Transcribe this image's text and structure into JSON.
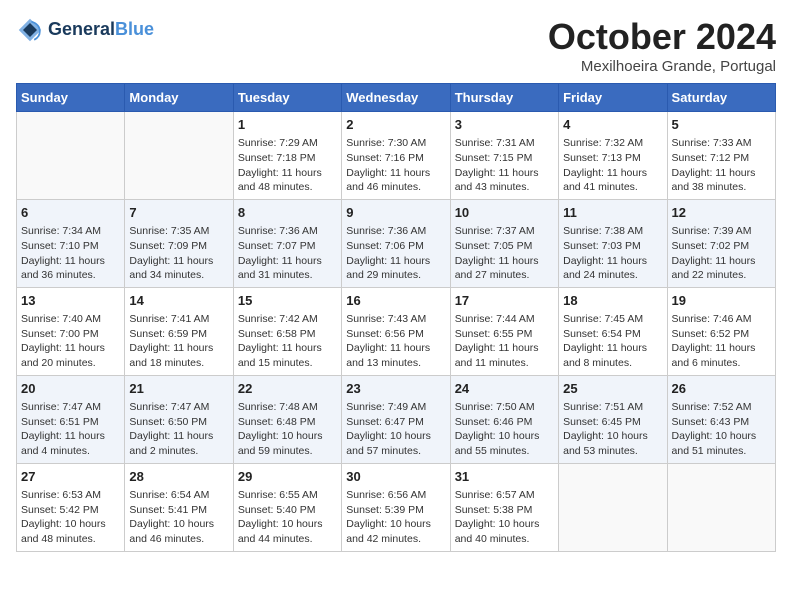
{
  "header": {
    "logo_line1": "General",
    "logo_line2": "Blue",
    "month": "October 2024",
    "location": "Mexilhoeira Grande, Portugal"
  },
  "days_of_week": [
    "Sunday",
    "Monday",
    "Tuesday",
    "Wednesday",
    "Thursday",
    "Friday",
    "Saturday"
  ],
  "weeks": [
    [
      {
        "day": "",
        "content": ""
      },
      {
        "day": "",
        "content": ""
      },
      {
        "day": "1",
        "content": "Sunrise: 7:29 AM\nSunset: 7:18 PM\nDaylight: 11 hours and 48 minutes."
      },
      {
        "day": "2",
        "content": "Sunrise: 7:30 AM\nSunset: 7:16 PM\nDaylight: 11 hours and 46 minutes."
      },
      {
        "day": "3",
        "content": "Sunrise: 7:31 AM\nSunset: 7:15 PM\nDaylight: 11 hours and 43 minutes."
      },
      {
        "day": "4",
        "content": "Sunrise: 7:32 AM\nSunset: 7:13 PM\nDaylight: 11 hours and 41 minutes."
      },
      {
        "day": "5",
        "content": "Sunrise: 7:33 AM\nSunset: 7:12 PM\nDaylight: 11 hours and 38 minutes."
      }
    ],
    [
      {
        "day": "6",
        "content": "Sunrise: 7:34 AM\nSunset: 7:10 PM\nDaylight: 11 hours and 36 minutes."
      },
      {
        "day": "7",
        "content": "Sunrise: 7:35 AM\nSunset: 7:09 PM\nDaylight: 11 hours and 34 minutes."
      },
      {
        "day": "8",
        "content": "Sunrise: 7:36 AM\nSunset: 7:07 PM\nDaylight: 11 hours and 31 minutes."
      },
      {
        "day": "9",
        "content": "Sunrise: 7:36 AM\nSunset: 7:06 PM\nDaylight: 11 hours and 29 minutes."
      },
      {
        "day": "10",
        "content": "Sunrise: 7:37 AM\nSunset: 7:05 PM\nDaylight: 11 hours and 27 minutes."
      },
      {
        "day": "11",
        "content": "Sunrise: 7:38 AM\nSunset: 7:03 PM\nDaylight: 11 hours and 24 minutes."
      },
      {
        "day": "12",
        "content": "Sunrise: 7:39 AM\nSunset: 7:02 PM\nDaylight: 11 hours and 22 minutes."
      }
    ],
    [
      {
        "day": "13",
        "content": "Sunrise: 7:40 AM\nSunset: 7:00 PM\nDaylight: 11 hours and 20 minutes."
      },
      {
        "day": "14",
        "content": "Sunrise: 7:41 AM\nSunset: 6:59 PM\nDaylight: 11 hours and 18 minutes."
      },
      {
        "day": "15",
        "content": "Sunrise: 7:42 AM\nSunset: 6:58 PM\nDaylight: 11 hours and 15 minutes."
      },
      {
        "day": "16",
        "content": "Sunrise: 7:43 AM\nSunset: 6:56 PM\nDaylight: 11 hours and 13 minutes."
      },
      {
        "day": "17",
        "content": "Sunrise: 7:44 AM\nSunset: 6:55 PM\nDaylight: 11 hours and 11 minutes."
      },
      {
        "day": "18",
        "content": "Sunrise: 7:45 AM\nSunset: 6:54 PM\nDaylight: 11 hours and 8 minutes."
      },
      {
        "day": "19",
        "content": "Sunrise: 7:46 AM\nSunset: 6:52 PM\nDaylight: 11 hours and 6 minutes."
      }
    ],
    [
      {
        "day": "20",
        "content": "Sunrise: 7:47 AM\nSunset: 6:51 PM\nDaylight: 11 hours and 4 minutes."
      },
      {
        "day": "21",
        "content": "Sunrise: 7:47 AM\nSunset: 6:50 PM\nDaylight: 11 hours and 2 minutes."
      },
      {
        "day": "22",
        "content": "Sunrise: 7:48 AM\nSunset: 6:48 PM\nDaylight: 10 hours and 59 minutes."
      },
      {
        "day": "23",
        "content": "Sunrise: 7:49 AM\nSunset: 6:47 PM\nDaylight: 10 hours and 57 minutes."
      },
      {
        "day": "24",
        "content": "Sunrise: 7:50 AM\nSunset: 6:46 PM\nDaylight: 10 hours and 55 minutes."
      },
      {
        "day": "25",
        "content": "Sunrise: 7:51 AM\nSunset: 6:45 PM\nDaylight: 10 hours and 53 minutes."
      },
      {
        "day": "26",
        "content": "Sunrise: 7:52 AM\nSunset: 6:43 PM\nDaylight: 10 hours and 51 minutes."
      }
    ],
    [
      {
        "day": "27",
        "content": "Sunrise: 6:53 AM\nSunset: 5:42 PM\nDaylight: 10 hours and 48 minutes."
      },
      {
        "day": "28",
        "content": "Sunrise: 6:54 AM\nSunset: 5:41 PM\nDaylight: 10 hours and 46 minutes."
      },
      {
        "day": "29",
        "content": "Sunrise: 6:55 AM\nSunset: 5:40 PM\nDaylight: 10 hours and 44 minutes."
      },
      {
        "day": "30",
        "content": "Sunrise: 6:56 AM\nSunset: 5:39 PM\nDaylight: 10 hours and 42 minutes."
      },
      {
        "day": "31",
        "content": "Sunrise: 6:57 AM\nSunset: 5:38 PM\nDaylight: 10 hours and 40 minutes."
      },
      {
        "day": "",
        "content": ""
      },
      {
        "day": "",
        "content": ""
      }
    ]
  ]
}
